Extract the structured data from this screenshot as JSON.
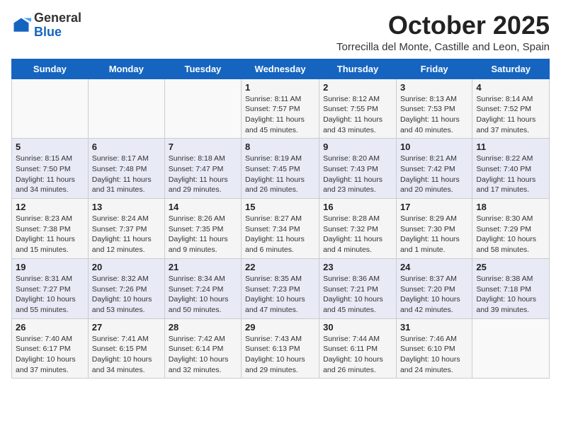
{
  "logo": {
    "general": "General",
    "blue": "Blue"
  },
  "header": {
    "month": "October 2025",
    "location": "Torrecilla del Monte, Castille and Leon, Spain"
  },
  "weekdays": [
    "Sunday",
    "Monday",
    "Tuesday",
    "Wednesday",
    "Thursday",
    "Friday",
    "Saturday"
  ],
  "weeks": [
    [
      {
        "day": "",
        "info": ""
      },
      {
        "day": "",
        "info": ""
      },
      {
        "day": "",
        "info": ""
      },
      {
        "day": "1",
        "info": "Sunrise: 8:11 AM\nSunset: 7:57 PM\nDaylight: 11 hours and 45 minutes."
      },
      {
        "day": "2",
        "info": "Sunrise: 8:12 AM\nSunset: 7:55 PM\nDaylight: 11 hours and 43 minutes."
      },
      {
        "day": "3",
        "info": "Sunrise: 8:13 AM\nSunset: 7:53 PM\nDaylight: 11 hours and 40 minutes."
      },
      {
        "day": "4",
        "info": "Sunrise: 8:14 AM\nSunset: 7:52 PM\nDaylight: 11 hours and 37 minutes."
      }
    ],
    [
      {
        "day": "5",
        "info": "Sunrise: 8:15 AM\nSunset: 7:50 PM\nDaylight: 11 hours and 34 minutes."
      },
      {
        "day": "6",
        "info": "Sunrise: 8:17 AM\nSunset: 7:48 PM\nDaylight: 11 hours and 31 minutes."
      },
      {
        "day": "7",
        "info": "Sunrise: 8:18 AM\nSunset: 7:47 PM\nDaylight: 11 hours and 29 minutes."
      },
      {
        "day": "8",
        "info": "Sunrise: 8:19 AM\nSunset: 7:45 PM\nDaylight: 11 hours and 26 minutes."
      },
      {
        "day": "9",
        "info": "Sunrise: 8:20 AM\nSunset: 7:43 PM\nDaylight: 11 hours and 23 minutes."
      },
      {
        "day": "10",
        "info": "Sunrise: 8:21 AM\nSunset: 7:42 PM\nDaylight: 11 hours and 20 minutes."
      },
      {
        "day": "11",
        "info": "Sunrise: 8:22 AM\nSunset: 7:40 PM\nDaylight: 11 hours and 17 minutes."
      }
    ],
    [
      {
        "day": "12",
        "info": "Sunrise: 8:23 AM\nSunset: 7:38 PM\nDaylight: 11 hours and 15 minutes."
      },
      {
        "day": "13",
        "info": "Sunrise: 8:24 AM\nSunset: 7:37 PM\nDaylight: 11 hours and 12 minutes."
      },
      {
        "day": "14",
        "info": "Sunrise: 8:26 AM\nSunset: 7:35 PM\nDaylight: 11 hours and 9 minutes."
      },
      {
        "day": "15",
        "info": "Sunrise: 8:27 AM\nSunset: 7:34 PM\nDaylight: 11 hours and 6 minutes."
      },
      {
        "day": "16",
        "info": "Sunrise: 8:28 AM\nSunset: 7:32 PM\nDaylight: 11 hours and 4 minutes."
      },
      {
        "day": "17",
        "info": "Sunrise: 8:29 AM\nSunset: 7:30 PM\nDaylight: 11 hours and 1 minute."
      },
      {
        "day": "18",
        "info": "Sunrise: 8:30 AM\nSunset: 7:29 PM\nDaylight: 10 hours and 58 minutes."
      }
    ],
    [
      {
        "day": "19",
        "info": "Sunrise: 8:31 AM\nSunset: 7:27 PM\nDaylight: 10 hours and 55 minutes."
      },
      {
        "day": "20",
        "info": "Sunrise: 8:32 AM\nSunset: 7:26 PM\nDaylight: 10 hours and 53 minutes."
      },
      {
        "day": "21",
        "info": "Sunrise: 8:34 AM\nSunset: 7:24 PM\nDaylight: 10 hours and 50 minutes."
      },
      {
        "day": "22",
        "info": "Sunrise: 8:35 AM\nSunset: 7:23 PM\nDaylight: 10 hours and 47 minutes."
      },
      {
        "day": "23",
        "info": "Sunrise: 8:36 AM\nSunset: 7:21 PM\nDaylight: 10 hours and 45 minutes."
      },
      {
        "day": "24",
        "info": "Sunrise: 8:37 AM\nSunset: 7:20 PM\nDaylight: 10 hours and 42 minutes."
      },
      {
        "day": "25",
        "info": "Sunrise: 8:38 AM\nSunset: 7:18 PM\nDaylight: 10 hours and 39 minutes."
      }
    ],
    [
      {
        "day": "26",
        "info": "Sunrise: 7:40 AM\nSunset: 6:17 PM\nDaylight: 10 hours and 37 minutes."
      },
      {
        "day": "27",
        "info": "Sunrise: 7:41 AM\nSunset: 6:15 PM\nDaylight: 10 hours and 34 minutes."
      },
      {
        "day": "28",
        "info": "Sunrise: 7:42 AM\nSunset: 6:14 PM\nDaylight: 10 hours and 32 minutes."
      },
      {
        "day": "29",
        "info": "Sunrise: 7:43 AM\nSunset: 6:13 PM\nDaylight: 10 hours and 29 minutes."
      },
      {
        "day": "30",
        "info": "Sunrise: 7:44 AM\nSunset: 6:11 PM\nDaylight: 10 hours and 26 minutes."
      },
      {
        "day": "31",
        "info": "Sunrise: 7:46 AM\nSunset: 6:10 PM\nDaylight: 10 hours and 24 minutes."
      },
      {
        "day": "",
        "info": ""
      }
    ]
  ]
}
